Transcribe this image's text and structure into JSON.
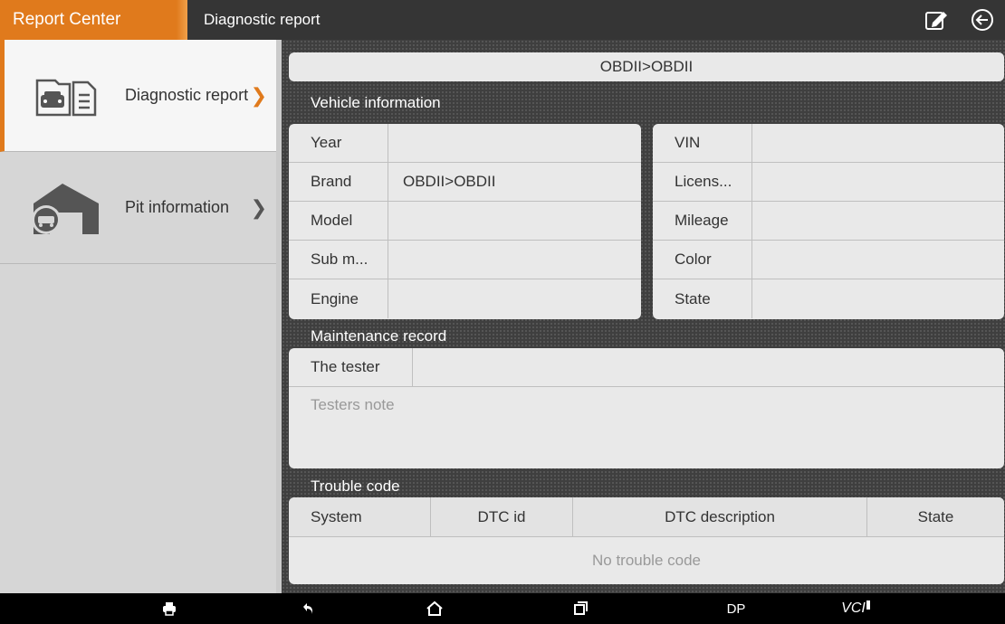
{
  "header": {
    "app_title": "Report Center",
    "page_title": "Diagnostic report"
  },
  "sidebar": {
    "items": [
      {
        "label": "Diagnostic report",
        "icon": "car-document-icon",
        "active": true
      },
      {
        "label": "Pit information",
        "icon": "garage-car-icon",
        "active": false
      }
    ]
  },
  "main": {
    "path": "OBDII>OBDII",
    "vehicle_section": "Vehicle information",
    "vehicle_left": [
      {
        "label": "Year",
        "value": ""
      },
      {
        "label": "Brand",
        "value": "OBDII>OBDII"
      },
      {
        "label": "Model",
        "value": ""
      },
      {
        "label": "Sub m...",
        "value": ""
      },
      {
        "label": "Engine",
        "value": ""
      }
    ],
    "vehicle_right": [
      {
        "label": "VIN",
        "value": ""
      },
      {
        "label": "Licens...",
        "value": ""
      },
      {
        "label": "Mileage",
        "value": ""
      },
      {
        "label": "Color",
        "value": ""
      },
      {
        "label": "State",
        "value": ""
      }
    ],
    "maintenance_section": "Maintenance record",
    "tester_label": "The tester",
    "tester_value": "",
    "note_placeholder": "Testers note",
    "trouble_section": "Trouble code",
    "dtc_columns": [
      "System",
      "DTC id",
      "DTC description",
      "State"
    ],
    "dtc_empty": "No trouble code"
  },
  "bottom_nav": {
    "dp_label": "DP",
    "vci_label": "VCI"
  },
  "colors": {
    "accent": "#e07a1c",
    "topbar": "#353535",
    "sidebar": "#d6d6d6"
  }
}
